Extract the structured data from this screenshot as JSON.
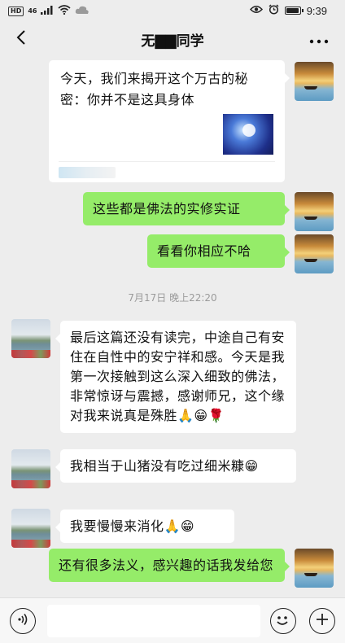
{
  "status_bar": {
    "hd": "HD",
    "network": "46",
    "time": "9:39",
    "battery_level": 0.85
  },
  "header": {
    "title": "无▇▇同学"
  },
  "messages": [
    {
      "id": "m1",
      "side": "right",
      "type": "link",
      "title": "今天，我们来揭开这个万古的秘密：你并不是这具身体"
    },
    {
      "id": "m2",
      "side": "right",
      "type": "text",
      "text": "这些都是佛法的实修实证"
    },
    {
      "id": "m3",
      "side": "right",
      "type": "text",
      "text": "看看你相应不哈"
    },
    {
      "id": "m4",
      "side": "left",
      "type": "text",
      "text": "最后这篇还没有读完，中途自己有安住在自性中的安宁祥和感。今天是我第一次接触到这么深入细致的佛法，非常惊讶与震撼，感谢师兄，这个缘对我来说真是殊胜🙏😁🌹"
    },
    {
      "id": "m5",
      "side": "left",
      "type": "text",
      "text": "我相当于山猪没有吃过细米糠😁"
    },
    {
      "id": "m6",
      "side": "left",
      "type": "text",
      "text": "我要慢慢来消化🙏😁"
    },
    {
      "id": "m7",
      "side": "right",
      "type": "text",
      "text": "还有很多法义，感兴趣的话我发给您"
    }
  ],
  "timestamp": "7月17日 晚上22:20",
  "icons": {
    "back": "back-arrow-icon",
    "more": "more-dots-icon",
    "voice": "voice-icon",
    "emoji": "emoji-icon",
    "plus": "plus-icon"
  },
  "colors": {
    "background": "#ededed",
    "self_bubble": "#95ec69",
    "other_bubble": "#ffffff"
  }
}
